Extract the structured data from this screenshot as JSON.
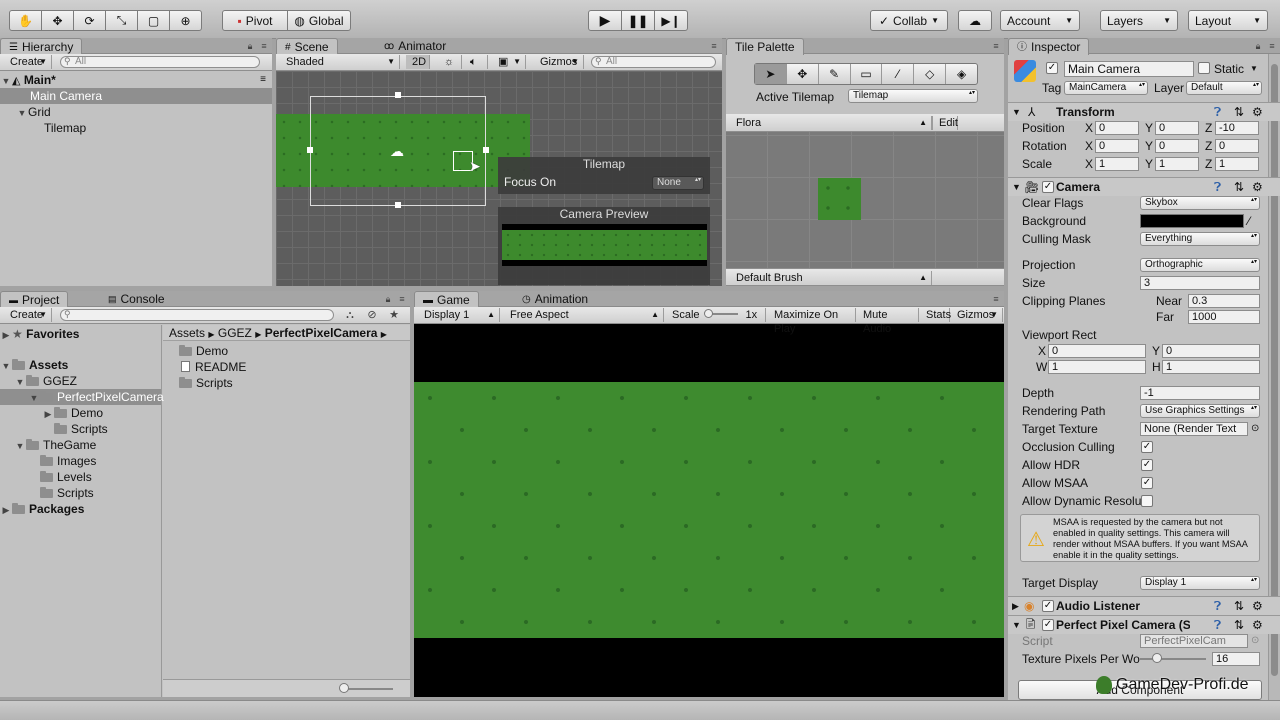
{
  "toolbar": {
    "pivot": "Pivot",
    "global": "Global",
    "collab": "Collab",
    "account": "Account",
    "layers": "Layers",
    "layout": "Layout"
  },
  "hierarchy": {
    "tab": "Hierarchy",
    "create": "Create",
    "search_placeholder": "All",
    "items": [
      {
        "label": "Main*"
      },
      {
        "label": "Main Camera"
      },
      {
        "label": "Grid"
      },
      {
        "label": "Tilemap"
      }
    ]
  },
  "scene": {
    "tab": "Scene",
    "animator_tab": "Animator",
    "shading": "Shaded",
    "mode_2d": "2D",
    "gizmos": "Gizmos",
    "search_placeholder": "All",
    "overlay": {
      "title": "Tilemap",
      "focus_label": "Focus On",
      "focus_value": "None",
      "preview_title": "Camera Preview"
    }
  },
  "palette": {
    "tab": "Tile Palette",
    "active_label": "Active Tilemap",
    "active_value": "Tilemap",
    "palette_name": "Flora",
    "edit": "Edit",
    "brush": "Default Brush"
  },
  "project": {
    "tab": "Project",
    "console_tab": "Console",
    "create": "Create",
    "favorites": "Favorites",
    "tree": [
      {
        "label": "Assets"
      },
      {
        "label": "GGEZ"
      },
      {
        "label": "PerfectPixelCamera"
      },
      {
        "label": "Demo"
      },
      {
        "label": "Scripts"
      },
      {
        "label": "TheGame"
      },
      {
        "label": "Images"
      },
      {
        "label": "Levels"
      },
      {
        "label": "Scripts"
      },
      {
        "label": "Packages"
      }
    ],
    "breadcrumb": [
      "Assets",
      "GGEZ",
      "PerfectPixelCamera"
    ],
    "files": [
      {
        "label": "Demo"
      },
      {
        "label": "README"
      },
      {
        "label": "Scripts"
      }
    ]
  },
  "game": {
    "tab": "Game",
    "animation_tab": "Animation",
    "display": "Display 1",
    "aspect": "Free Aspect",
    "scale_label": "Scale",
    "scale_value": "1x",
    "maximize": "Maximize On Play",
    "mute": "Mute Audio",
    "stats": "Stats",
    "gizmos": "Gizmos"
  },
  "inspector": {
    "tab": "Inspector",
    "object_name": "Main Camera",
    "static_label": "Static",
    "tag_label": "Tag",
    "tag_value": "MainCamera",
    "layer_label": "Layer",
    "layer_value": "Default",
    "transform": {
      "title": "Transform",
      "rows": [
        {
          "label": "Position",
          "x": "0",
          "y": "0",
          "z": "-10"
        },
        {
          "label": "Rotation",
          "x": "0",
          "y": "0",
          "z": "0"
        },
        {
          "label": "Scale",
          "x": "1",
          "y": "1",
          "z": "1"
        }
      ]
    },
    "camera": {
      "title": "Camera",
      "clear_flags_label": "Clear Flags",
      "clear_flags": "Skybox",
      "background_label": "Background",
      "culling_label": "Culling Mask",
      "culling": "Everything",
      "projection_label": "Projection",
      "projection": "Orthographic",
      "size_label": "Size",
      "size": "3",
      "clipping_label": "Clipping Planes",
      "near_label": "Near",
      "near": "0.3",
      "far_label": "Far",
      "far": "1000",
      "viewport_label": "Viewport Rect",
      "vx": "0",
      "vy": "0",
      "vw": "1",
      "vh": "1",
      "depth_label": "Depth",
      "depth": "-1",
      "rendering_label": "Rendering Path",
      "rendering": "Use Graphics Settings",
      "target_texture_label": "Target Texture",
      "target_texture": "None (Render Text",
      "occlusion_label": "Occlusion Culling",
      "hdr_label": "Allow HDR",
      "msaa_label": "Allow MSAA",
      "dynres_label": "Allow Dynamic Resolu",
      "warning": "MSAA is requested by the camera but not enabled in quality settings. This camera will render without MSAA buffers. If you want MSAA enable it in the quality settings.",
      "target_display_label": "Target Display",
      "target_display": "Display 1"
    },
    "audio_listener": "Audio Listener",
    "ppc": {
      "title": "Perfect Pixel Camera (S",
      "script_label": "Script",
      "script": "PerfectPixelCam",
      "tppw_label": "Texture Pixels Per Wo",
      "tppw": "16"
    },
    "add_component": "Add Component"
  },
  "watermark": "GameDev-Profi.de",
  "colors": {
    "grass": "#3d8a2d",
    "selection": "#8f8f8f",
    "background_swatch": "#000000"
  }
}
